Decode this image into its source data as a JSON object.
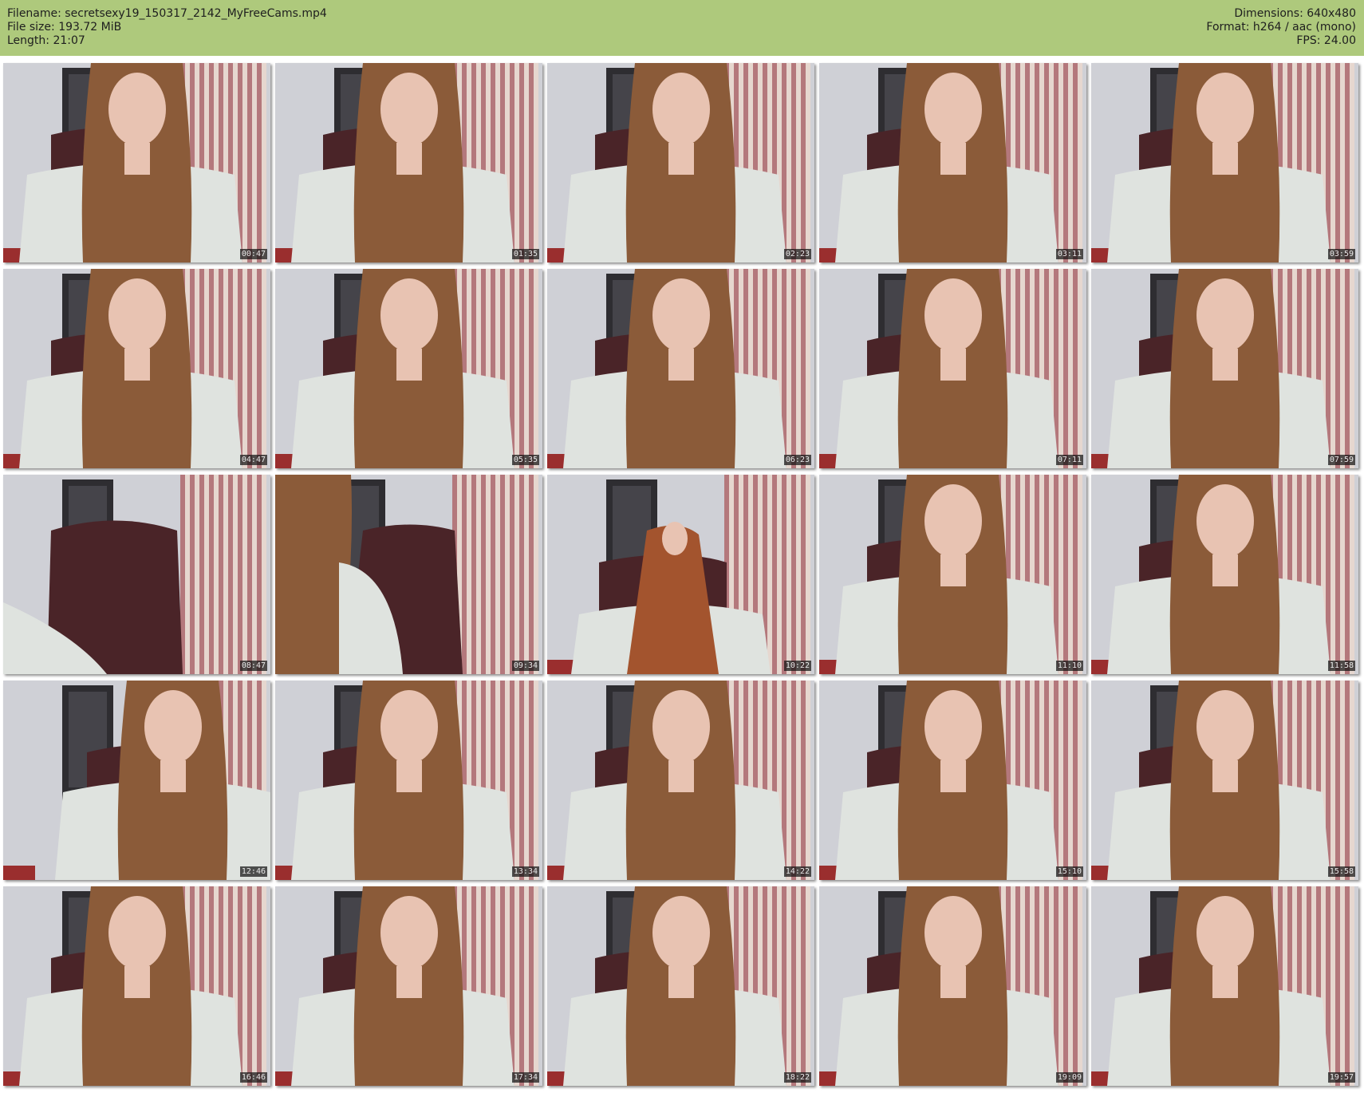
{
  "header": {
    "filename": "Filename: secretsexy19_150317_2142_MyFreeCams.mp4",
    "filesize": "File size: 193.72 MiB",
    "length": "Length: 21:07",
    "dimensions": "Dimensions: 640x480",
    "format": "Format: h264 / aac (mono)",
    "fps": "FPS: 24.00"
  },
  "colors": {
    "header_bg": "#aec97c",
    "wall": "#cfd0d6",
    "door": "#2e2d31",
    "chair": "#4a2428",
    "stripe_red": "#b4787c",
    "stripe_cream": "#e6d7cf",
    "hair": "#8b5b39",
    "skin": "#e8c3b2",
    "sweater": "#dfe3df"
  },
  "thumbnails": [
    {
      "time": "00:47",
      "scene": "person"
    },
    {
      "time": "01:35",
      "scene": "person"
    },
    {
      "time": "02:23",
      "scene": "person"
    },
    {
      "time": "03:11",
      "scene": "person"
    },
    {
      "time": "03:59",
      "scene": "person"
    },
    {
      "time": "04:47",
      "scene": "person"
    },
    {
      "time": "05:35",
      "scene": "person"
    },
    {
      "time": "06:23",
      "scene": "person"
    },
    {
      "time": "07:11",
      "scene": "person"
    },
    {
      "time": "07:59",
      "scene": "person"
    },
    {
      "time": "08:47",
      "scene": "chair"
    },
    {
      "time": "09:34",
      "scene": "side"
    },
    {
      "time": "10:22",
      "scene": "far"
    },
    {
      "time": "11:10",
      "scene": "person"
    },
    {
      "time": "11:58",
      "scene": "person"
    },
    {
      "time": "12:46",
      "scene": "person-right"
    },
    {
      "time": "13:34",
      "scene": "person"
    },
    {
      "time": "14:22",
      "scene": "person"
    },
    {
      "time": "15:10",
      "scene": "person"
    },
    {
      "time": "15:58",
      "scene": "person"
    },
    {
      "time": "16:46",
      "scene": "person"
    },
    {
      "time": "17:34",
      "scene": "person"
    },
    {
      "time": "18:22",
      "scene": "person"
    },
    {
      "time": "19:09",
      "scene": "person"
    },
    {
      "time": "19:57",
      "scene": "person"
    }
  ]
}
